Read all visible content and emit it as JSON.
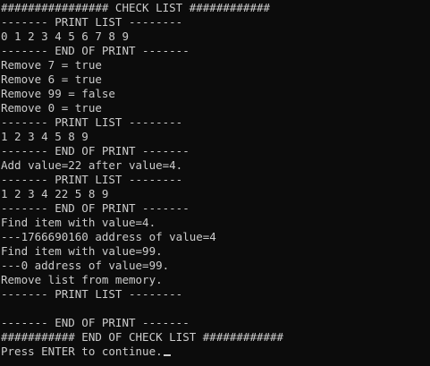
{
  "console": {
    "lines": [
      "################ CHECK LIST ############",
      "------- PRINT LIST --------",
      "0 1 2 3 4 5 6 7 8 9",
      "------- END OF PRINT -------",
      "Remove 7 = true",
      "Remove 6 = true",
      "Remove 99 = false",
      "Remove 0 = true",
      "------- PRINT LIST --------",
      "1 2 3 4 5 8 9",
      "------- END OF PRINT -------",
      "Add value=22 after value=4.",
      "------- PRINT LIST --------",
      "1 2 3 4 22 5 8 9",
      "------- END OF PRINT -------",
      "Find item with value=4.",
      "---1766690160 address of value=4",
      "Find item with value=99.",
      "---0 address of value=99.",
      "Remove list from memory.",
      "------- PRINT LIST --------",
      "",
      "------- END OF PRINT -------",
      "########### END OF CHECK LIST ############",
      "Press ENTER to continue."
    ],
    "colors": {
      "background": "#0c0c0c",
      "text": "#cccccc"
    }
  }
}
